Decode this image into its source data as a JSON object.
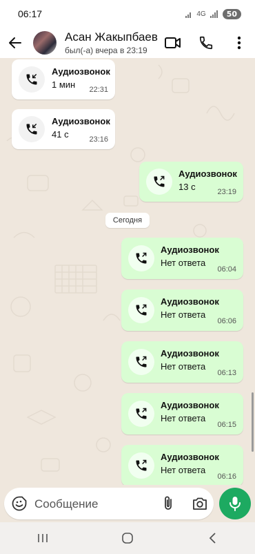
{
  "status_bar": {
    "time": "06:17",
    "network": "4G",
    "battery": "50"
  },
  "header": {
    "contact_name": "Асан Жакыпбаев",
    "last_seen": "был(-а) вчера в 23:19",
    "icons": [
      "back-arrow-icon",
      "video-call-icon",
      "voice-call-icon",
      "more-options-icon"
    ]
  },
  "messages": [
    {
      "direction": "incoming",
      "title": "Аудиозвонок",
      "subtitle": "1 мин",
      "time": "22:31"
    },
    {
      "direction": "incoming",
      "title": "Аудиозвонок",
      "subtitle": "41 с",
      "time": "23:16"
    },
    {
      "direction": "outgoing",
      "title": "Аудиозвонок",
      "subtitle": "13 с",
      "time": "23:19"
    },
    {
      "direction": "outgoing",
      "title": "Аудиозвонок",
      "subtitle": "Нет ответа",
      "time": "06:04"
    },
    {
      "direction": "outgoing",
      "title": "Аудиозвонок",
      "subtitle": "Нет ответа",
      "time": "06:06"
    },
    {
      "direction": "outgoing",
      "title": "Аудиозвонок",
      "subtitle": "Нет ответа",
      "time": "06:13"
    },
    {
      "direction": "outgoing",
      "title": "Аудиозвонок",
      "subtitle": "Нет ответа",
      "time": "06:15"
    },
    {
      "direction": "outgoing",
      "title": "Аудиозвонок",
      "subtitle": "Нет ответа",
      "time": "06:16"
    }
  ],
  "date_divider": "Сегодня",
  "composer": {
    "placeholder": "Сообщение",
    "icons": [
      "emoji-icon",
      "attach-icon",
      "camera-icon",
      "microphone-icon"
    ]
  },
  "colors": {
    "outgoing_bubble": "#d9fdd3",
    "incoming_bubble": "#ffffff",
    "chat_background": "#efe7dd",
    "accent": "#1daa61"
  },
  "nav_bar": {
    "icons": [
      "recent-apps-icon",
      "home-icon",
      "back-icon"
    ]
  }
}
